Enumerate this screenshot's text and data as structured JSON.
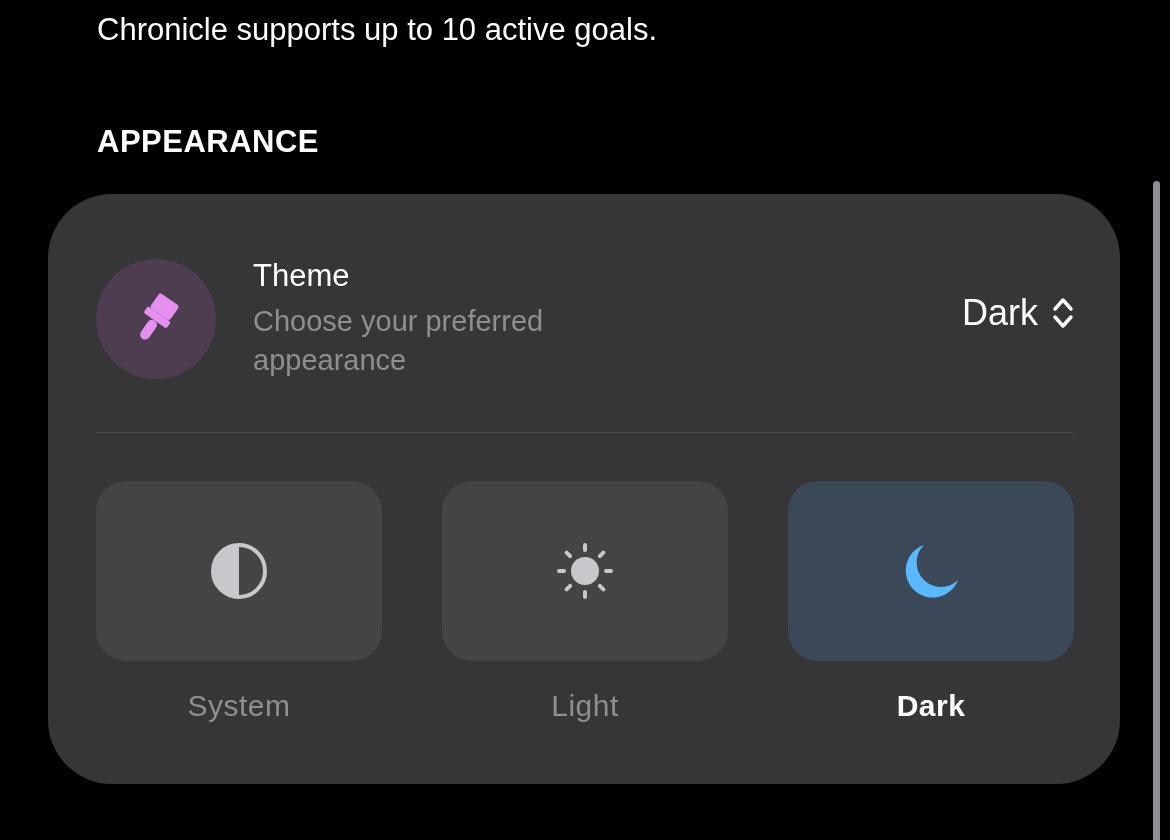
{
  "intro_text": "Chronicle supports up to 10 active goals.",
  "section_title": "APPEARANCE",
  "theme": {
    "title": "Theme",
    "subtitle": "Choose your preferred appearance",
    "value": "Dark",
    "options": [
      {
        "label": "System",
        "kind": "system",
        "selected": false
      },
      {
        "label": "Light",
        "kind": "light",
        "selected": false
      },
      {
        "label": "Dark",
        "kind": "dark",
        "selected": true
      }
    ]
  }
}
